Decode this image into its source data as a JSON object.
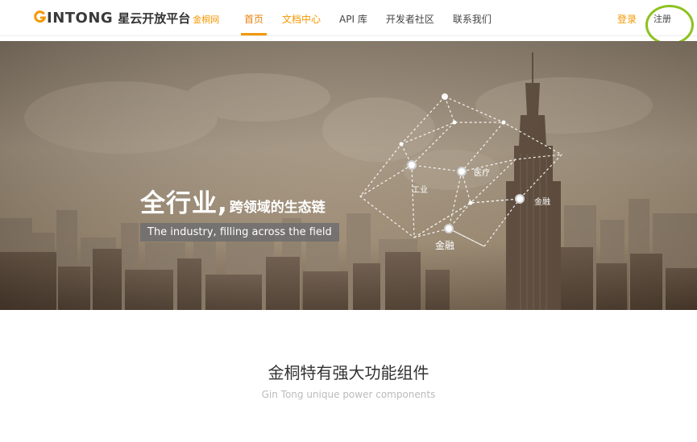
{
  "header": {
    "logo_word": "INTONG",
    "logo_cn": "星云开放平台",
    "logo_sub": "金桐网",
    "nav": [
      {
        "label": "首页",
        "state": "active"
      },
      {
        "label": "文档中心",
        "state": "highlight"
      },
      {
        "label": "API 库",
        "state": "normal"
      },
      {
        "label": "开发者社区",
        "state": "normal"
      },
      {
        "label": "联系我们",
        "state": "normal"
      }
    ],
    "login_label": "登录",
    "register_label": "注册"
  },
  "banner": {
    "headline_main": "全行业,",
    "headline_sub": "跨领域的生态链",
    "tagline": "The industry, filling across the field",
    "node_labels": {
      "industry": "工业",
      "medical": "医疗",
      "finance_right": "金融",
      "finance_bottom": "金融"
    }
  },
  "features": {
    "title": "金桐特有强大功能组件",
    "subtitle": "Gin Tong unique power components"
  },
  "colors": {
    "accent": "#f39800",
    "highlight_ring": "#8dc21f",
    "banner_tone": "#8c7c68"
  }
}
